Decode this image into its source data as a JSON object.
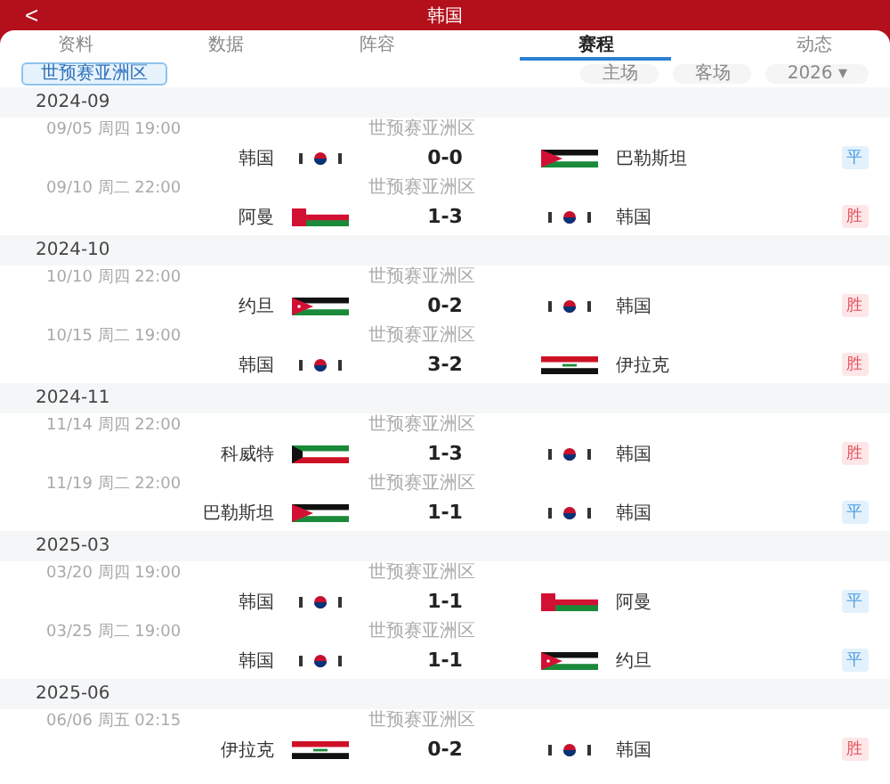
{
  "header": {
    "back": "<",
    "title": "韩国"
  },
  "tabs": [
    {
      "label": "资料",
      "selected": false
    },
    {
      "label": "数据",
      "selected": false
    },
    {
      "label": "阵容",
      "selected": false
    },
    {
      "label": "赛程",
      "selected": true
    },
    {
      "label": "动态",
      "selected": false
    }
  ],
  "filters": {
    "competition": {
      "label": "世预赛亚洲区",
      "selected": true
    },
    "venue": [
      {
        "label": "主场",
        "selected": false
      },
      {
        "label": "客场",
        "selected": false
      }
    ],
    "season": {
      "value": "2026",
      "caret": "▾"
    }
  },
  "months": [
    {
      "month": "2024-09",
      "matches": [
        {
          "time": "09/05  周四 19:00",
          "competition": "世预赛亚洲区",
          "home": {
            "name": "韩国",
            "kind": "korea"
          },
          "score": "0-0",
          "away": {
            "name": "巴勒斯坦",
            "kind": "palestine"
          },
          "result": {
            "label": "平",
            "kind": "draw"
          }
        },
        {
          "time": "09/10  周二 22:00",
          "competition": "世预赛亚洲区",
          "home": {
            "name": "阿曼",
            "kind": "oman"
          },
          "score": "1-3",
          "away": {
            "name": "韩国",
            "kind": "korea"
          },
          "result": {
            "label": "胜",
            "kind": "win"
          }
        }
      ]
    },
    {
      "month": "2024-10",
      "matches": [
        {
          "time": "10/10  周四 22:00",
          "competition": "世预赛亚洲区",
          "home": {
            "name": "约旦",
            "kind": "jordan"
          },
          "score": "0-2",
          "away": {
            "name": "韩国",
            "kind": "korea"
          },
          "result": {
            "label": "胜",
            "kind": "win"
          }
        },
        {
          "time": "10/15  周二 19:00",
          "competition": "世预赛亚洲区",
          "home": {
            "name": "韩国",
            "kind": "korea"
          },
          "score": "3-2",
          "away": {
            "name": "伊拉克",
            "kind": "iraq"
          },
          "result": {
            "label": "胜",
            "kind": "win"
          }
        }
      ]
    },
    {
      "month": "2024-11",
      "matches": [
        {
          "time": "11/14  周四 22:00",
          "competition": "世预赛亚洲区",
          "home": {
            "name": "科威特",
            "kind": "kuwait"
          },
          "score": "1-3",
          "away": {
            "name": "韩国",
            "kind": "korea"
          },
          "result": {
            "label": "胜",
            "kind": "win"
          }
        },
        {
          "time": "11/19  周二 22:00",
          "competition": "世预赛亚洲区",
          "home": {
            "name": "巴勒斯坦",
            "kind": "palestine"
          },
          "score": "1-1",
          "away": {
            "name": "韩国",
            "kind": "korea"
          },
          "result": {
            "label": "平",
            "kind": "draw"
          }
        }
      ]
    },
    {
      "month": "2025-03",
      "matches": [
        {
          "time": "03/20  周四 19:00",
          "competition": "世预赛亚洲区",
          "home": {
            "name": "韩国",
            "kind": "korea"
          },
          "score": "1-1",
          "away": {
            "name": "阿曼",
            "kind": "oman"
          },
          "result": {
            "label": "平",
            "kind": "draw"
          }
        },
        {
          "time": "03/25  周二 19:00",
          "competition": "世预赛亚洲区",
          "home": {
            "name": "韩国",
            "kind": "korea"
          },
          "score": "1-1",
          "away": {
            "name": "约旦",
            "kind": "jordan"
          },
          "result": {
            "label": "平",
            "kind": "draw"
          }
        }
      ]
    },
    {
      "month": "2025-06",
      "matches": [
        {
          "time": "06/06  周五 02:15",
          "competition": "世预赛亚洲区",
          "home": {
            "name": "伊拉克",
            "kind": "iraq"
          },
          "score": "0-2",
          "away": {
            "name": "韩国",
            "kind": "korea"
          },
          "result": {
            "label": "胜",
            "kind": "win"
          }
        }
      ]
    }
  ]
}
